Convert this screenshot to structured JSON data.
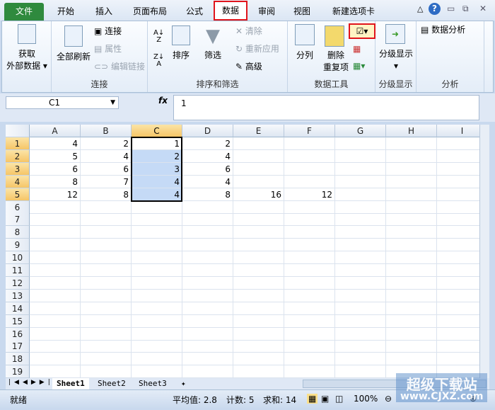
{
  "tabs": [
    "文件",
    "开始",
    "插入",
    "页面布局",
    "公式",
    "数据",
    "审阅",
    "视图",
    "新建选项卡"
  ],
  "ribbon": {
    "get_external": [
      "获取",
      "外部数据"
    ],
    "refresh_all": "全部刷新",
    "connections": "连接",
    "properties": "属性",
    "edit_links": "编辑链接",
    "group_connections": "连接",
    "sort": "排序",
    "filter": "筛选",
    "clear": "清除",
    "reapply": "重新应用",
    "advanced": "高级",
    "group_sort": "排序和筛选",
    "text_to_columns": "分列",
    "remove_dup": [
      "删除",
      "重复项"
    ],
    "group_tools": "数据工具",
    "outline": "分级显示",
    "group_outline": "分级显示",
    "data_analysis": "数据分析",
    "group_analysis": "分析"
  },
  "formula": {
    "namebox": "C1",
    "fx": "fx",
    "value": "1"
  },
  "columns": [
    "A",
    "B",
    "C",
    "D",
    "E",
    "F",
    "G",
    "H",
    "I"
  ],
  "rows": [
    "1",
    "2",
    "3",
    "4",
    "5",
    "6",
    "7",
    "8",
    "9",
    "10",
    "11",
    "12",
    "13",
    "14",
    "15",
    "16",
    "17",
    "18",
    "19"
  ],
  "cells": [
    [
      "4",
      "2",
      "1",
      "2",
      "",
      "",
      "",
      "",
      ""
    ],
    [
      "5",
      "4",
      "2",
      "4",
      "",
      "",
      "",
      "",
      ""
    ],
    [
      "6",
      "6",
      "3",
      "6",
      "",
      "",
      "",
      "",
      ""
    ],
    [
      "8",
      "7",
      "4",
      "4",
      "",
      "",
      "",
      "",
      ""
    ],
    [
      "12",
      "8",
      "4",
      "8",
      "16",
      "12",
      "",
      "",
      ""
    ]
  ],
  "sheets": [
    "Sheet1",
    "Sheet2",
    "Sheet3"
  ],
  "status": {
    "ready": "就绪",
    "avg": "平均值: 2.8",
    "count": "计数: 5",
    "sum": "求和: 14",
    "zoom": "100%"
  },
  "watermark": [
    "超级下载站",
    "www.CJXZ.com"
  ]
}
